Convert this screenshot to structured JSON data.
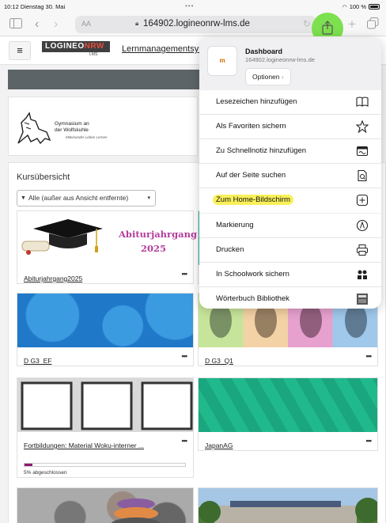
{
  "status": {
    "time": "10:12",
    "date": "Dienstag 30. Mai",
    "battery": "100 %"
  },
  "browser": {
    "text_size": "AA",
    "url": "164902.logineonrw-lms.de"
  },
  "header": {
    "logo_main": "LOGINEO",
    "logo_accent": "NRW",
    "logo_sub": "LMS",
    "nav_link": "Lernmanagementsys"
  },
  "school": {
    "name_line1": "Gymnasium an",
    "name_line2": "der Wolfskuhle",
    "tagline": "Miteinander Leben Lernen"
  },
  "courses": {
    "title": "Kursübersicht",
    "filter": "Alle (außer aus Ansicht entfernte)",
    "items": [
      {
        "title": "Abiturjahrgang2025",
        "banner_line1": "Abiturjahrgang",
        "banner_line2": "2025",
        "more": "•••"
      },
      {
        "title": "D G3_EF",
        "more": "•••"
      },
      {
        "title": "D G3_Q1",
        "more": "•••"
      },
      {
        "title": "Fortbildungen: Material Woku-interner ...",
        "more": "•••",
        "progress": 0.05,
        "progress_text": "5% abgeschlossen"
      },
      {
        "title": "JapanAG",
        "more": "•••"
      }
    ]
  },
  "share_sheet": {
    "title": "Dashboard",
    "url": "164902.logineonrw-lms.de",
    "options_label": "Optionen",
    "options_chevron": "›",
    "group1": [
      {
        "label": "Lesezeichen hinzufügen",
        "icon": "book-icon"
      },
      {
        "label": "Als Favoriten sichern",
        "icon": "star-icon"
      },
      {
        "label": "Zu Schnellnotiz hinzufügen",
        "icon": "quicknote-icon"
      },
      {
        "label": "Auf der Seite suchen",
        "icon": "find-in-page-icon"
      },
      {
        "label": "Zum Home-Bildschirm",
        "icon": "add-square-icon"
      }
    ],
    "group2": [
      {
        "label": "Markierung",
        "icon": "markup-icon"
      },
      {
        "label": "Drucken",
        "icon": "printer-icon"
      },
      {
        "label": "In Schoolwork sichern",
        "icon": "schoolwork-icon"
      },
      {
        "label": "Wörterbuch Bibliothek",
        "icon": "dictionary-icon"
      }
    ],
    "highlight_color": "#f9f05a"
  }
}
